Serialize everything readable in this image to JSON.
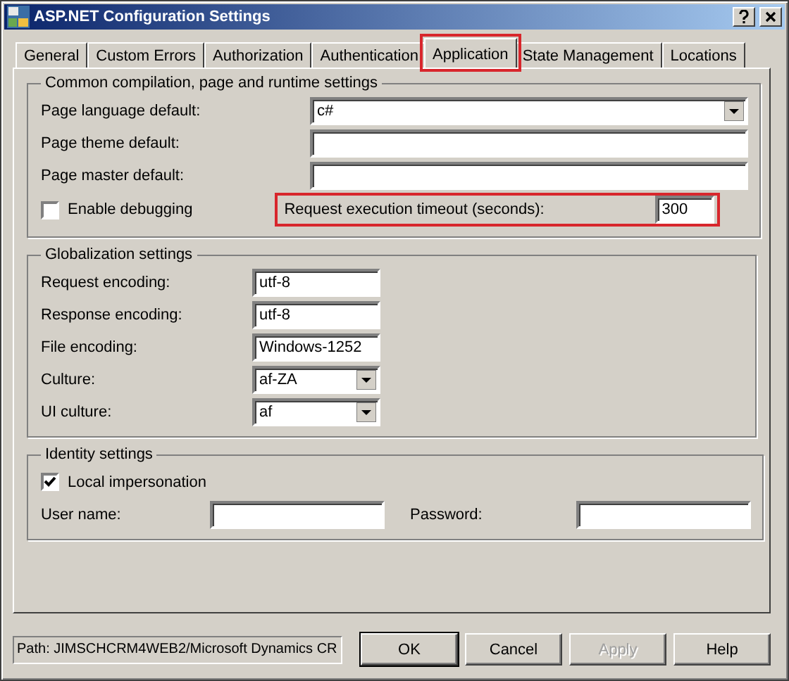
{
  "window": {
    "title": "ASP.NET Configuration Settings"
  },
  "tabs": [
    {
      "label": "General",
      "selected": false,
      "highlighted": false
    },
    {
      "label": "Custom Errors",
      "selected": false,
      "highlighted": false
    },
    {
      "label": "Authorization",
      "selected": false,
      "highlighted": false
    },
    {
      "label": "Authentication",
      "selected": false,
      "highlighted": false
    },
    {
      "label": "Application",
      "selected": true,
      "highlighted": true
    },
    {
      "label": "State Management",
      "selected": false,
      "highlighted": false
    },
    {
      "label": "Locations",
      "selected": false,
      "highlighted": false
    }
  ],
  "compilation": {
    "title": "Common compilation, page and runtime settings",
    "fields": [
      {
        "label": "Page language default:",
        "kind": "dropdown",
        "value": "c#"
      },
      {
        "label": "Page theme default:",
        "kind": "text"
      },
      {
        "label": "Page master default:",
        "kind": "text"
      }
    ],
    "debugging": {
      "label": "Enable debugging",
      "checked": false
    },
    "timeout": {
      "label": "Request execution timeout (seconds):",
      "value": "300",
      "highlighted": true
    }
  },
  "globalization": {
    "title": "Globalization settings",
    "fields": [
      {
        "label": "Request encoding:",
        "kind": "text",
        "value": "utf-8"
      },
      {
        "label": "Response encoding:",
        "kind": "text",
        "value": "utf-8"
      },
      {
        "label": "File encoding:",
        "kind": "text",
        "value": "Windows-1252"
      },
      {
        "label": "Culture:",
        "kind": "dropdown",
        "value": "af-ZA"
      },
      {
        "label": "UI culture:",
        "kind": "dropdown",
        "value": "af"
      }
    ]
  },
  "identity": {
    "title": "Identity settings",
    "impersonation": {
      "label": "Local impersonation",
      "checked": true
    },
    "user_name": {
      "label": "User name:"
    },
    "password": {
      "label": "Password:"
    }
  },
  "status": {
    "path": "Path: JIMSCHCRM4WEB2/Microsoft Dynamics CR"
  },
  "buttons": [
    {
      "label": "OK",
      "default": true,
      "disabled": false
    },
    {
      "label": "Cancel",
      "default": false,
      "disabled": false
    },
    {
      "label": "Apply",
      "default": false,
      "disabled": true
    },
    {
      "label": "Help",
      "default": false,
      "disabled": false
    }
  ]
}
